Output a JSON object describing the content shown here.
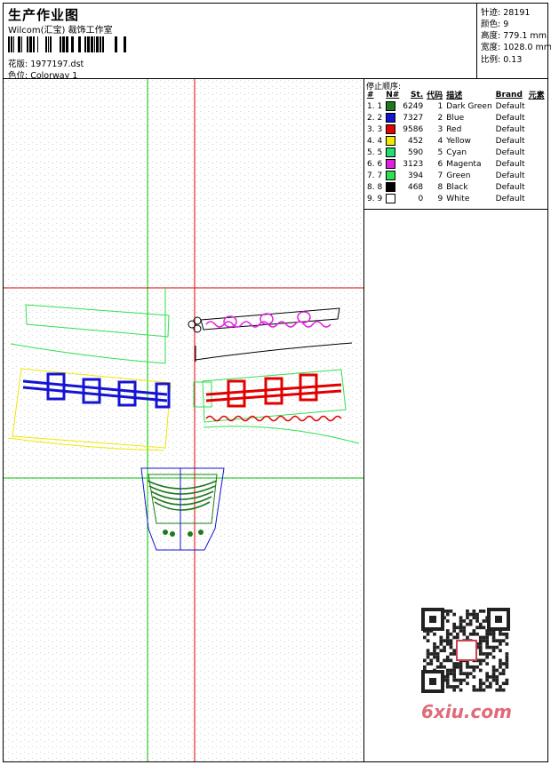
{
  "header": {
    "title": "生产作业图",
    "company": "Wilcom(汇宝) 裁饰工作室",
    "file_label": "花版: 1977197.dst",
    "colorway_label": "色位: Colorway 1"
  },
  "stats": {
    "stitches": "针迹: 28191",
    "colors": "颜色: 9",
    "height": "高度: 779.1 mm",
    "width": "宽度: 1028.0 mm",
    "scale": "比例: 0.13"
  },
  "legend": {
    "stop_title": "停止顺序:",
    "headers": [
      "#",
      "N#",
      "St.",
      "代码",
      "描述",
      "Brand",
      "元素"
    ],
    "rows": [
      {
        "idx": "1. 1",
        "color": "#1e7a1e",
        "stitches": "6249",
        "code": "1",
        "desc": "Dark Green",
        "brand": "Default"
      },
      {
        "idx": "2. 2",
        "color": "#1414d2",
        "stitches": "7327",
        "code": "2",
        "desc": "Blue",
        "brand": "Default"
      },
      {
        "idx": "3. 3",
        "color": "#e00000",
        "stitches": "9586",
        "code": "3",
        "desc": "Red",
        "brand": "Default"
      },
      {
        "idx": "4. 4",
        "color": "#f0e800",
        "stitches": "452",
        "code": "4",
        "desc": "Yellow",
        "brand": "Default"
      },
      {
        "idx": "5. 5",
        "color": "#20e070",
        "stitches": "590",
        "code": "5",
        "desc": "Cyan",
        "brand": "Default"
      },
      {
        "idx": "6. 6",
        "color": "#e020e0",
        "stitches": "3123",
        "code": "6",
        "desc": "Magenta",
        "brand": "Default"
      },
      {
        "idx": "7. 7",
        "color": "#30e050",
        "stitches": "394",
        "code": "7",
        "desc": "Green",
        "brand": "Default"
      },
      {
        "idx": "8. 8",
        "color": "#000000",
        "stitches": "468",
        "code": "8",
        "desc": "Black",
        "brand": "Default"
      },
      {
        "idx": "9. 9",
        "color": "#ffffff",
        "stitches": "0",
        "code": "9",
        "desc": "White",
        "brand": "Default"
      }
    ]
  },
  "watermark": "6xiu.com"
}
